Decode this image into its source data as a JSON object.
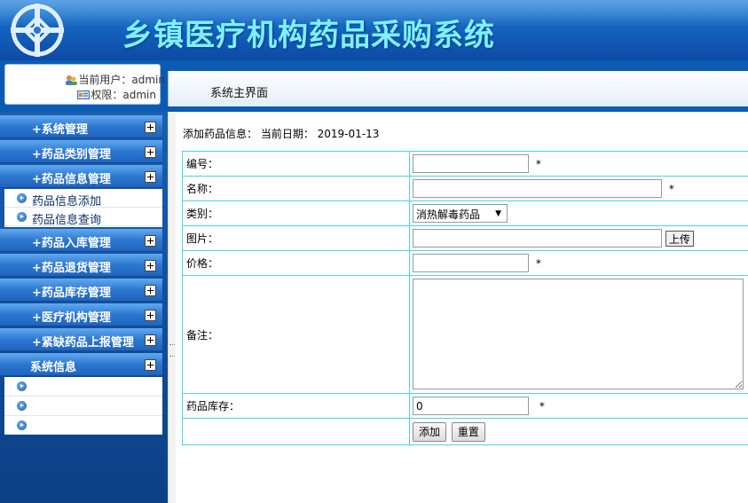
{
  "header": {
    "title": "乡镇医疗机构药品采购系统",
    "logo_icon": "cross-emblem-icon"
  },
  "user": {
    "current_user": "当前用户：admin",
    "permission": "权限：admin"
  },
  "breadcrumb": {
    "text": "系统主界面"
  },
  "sidebar": {
    "menus": [
      {
        "label": "+系统管理"
      },
      {
        "label": "+药品类别管理"
      },
      {
        "label": "+药品信息管理"
      },
      {
        "label": "+药品入库管理"
      },
      {
        "label": "+药品退货管理"
      },
      {
        "label": "+药品库存管理"
      },
      {
        "label": "+医疗机构管理"
      },
      {
        "label": "+紧缺药品上报管理"
      },
      {
        "label": "系统信息"
      }
    ],
    "drug_info_subitems": [
      "药品信息添加",
      "药品信息查询"
    ],
    "system_info_subitems": [
      "",
      "",
      ""
    ]
  },
  "form": {
    "caption": "添加药品信息：  当前日期：  2019-01-13",
    "fields": {
      "code_label": "编号：",
      "name_label": "名称：",
      "category_label": "类别：",
      "category_value": "消热解毒药品",
      "image_label": "图片：",
      "upload_button": "上传",
      "price_label": "价格：",
      "note_label": "备注：",
      "stock_label": "药品库存：",
      "stock_value": "0",
      "required_mark": "*"
    },
    "buttons": {
      "add": "添加",
      "reset": "重置"
    }
  },
  "colors": {
    "header_blue": "#1565c0",
    "title_cyan": "#7ff0ff",
    "table_border": "#46d6e0"
  }
}
